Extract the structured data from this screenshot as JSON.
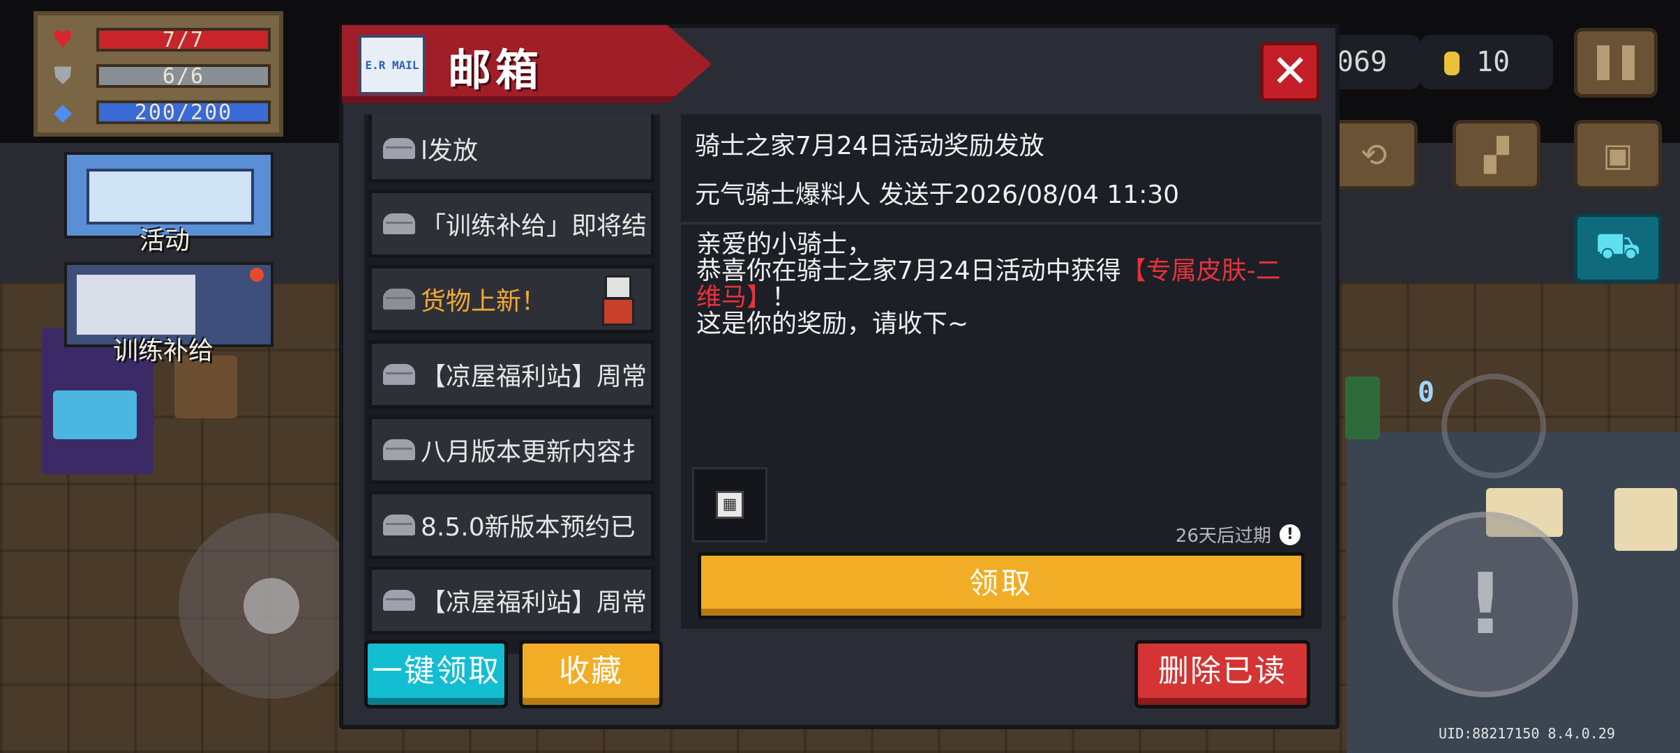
{
  "hud": {
    "hp": "7/7",
    "armor": "6/6",
    "energy": "200/200",
    "gems": "069",
    "coins": "10"
  },
  "banners": {
    "activity": "活动",
    "training": "训练补给"
  },
  "joystick": {
    "counter": "0"
  },
  "mailbox": {
    "title": "邮箱",
    "mail_icon_text": "E.R MAIL",
    "list": [
      {
        "text": "l发放",
        "state": "read"
      },
      {
        "text": "「训练补给」即将结",
        "state": "read"
      },
      {
        "text": "货物上新！",
        "state": "new"
      },
      {
        "text": "【凉屋福利站】周常",
        "state": "read"
      },
      {
        "text": "八月版本更新内容扌",
        "state": "read"
      },
      {
        "text": "8.5.0新版本预约已",
        "state": "read"
      },
      {
        "text": "【凉屋福利站】周常",
        "state": "read"
      }
    ],
    "buttons": {
      "claim_all": "一键领取",
      "favorite": "收藏",
      "delete_read": "删除已读"
    },
    "detail": {
      "title": "骑士之家7月24日活动奖励发放",
      "sender": "元气骑士爆料人 发送于2026/08/04 11:30",
      "body_1": "亲爱的小骑士，",
      "body_2a": "恭喜你在骑士之家7月24日活动中获得",
      "body_2b": "【专属皮肤-二维马】",
      "body_2c": "！",
      "body_3": "这是你的奖励，请收下~",
      "expire": "26天后过期",
      "claim": "领取"
    }
  },
  "footer": {
    "uid": "UID:88217150 8.4.0.29"
  },
  "colors": {
    "ribbon": "#a01e28",
    "highlight": "#e8323a",
    "new_mail": "#f4a934",
    "claim": "#f1ad25",
    "claim_all": "#13bdd2",
    "delete": "#d43434"
  }
}
